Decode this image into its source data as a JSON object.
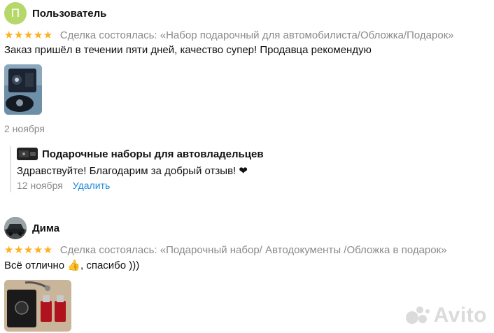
{
  "reviews": [
    {
      "avatar_letter": "П",
      "author": "Пользователь",
      "stars": "★★★★★",
      "rating": 5,
      "deal": "Сделка состоялась: «Набор подарочный для автомобилиста/Обложка/Подарок»",
      "text": "Заказ пришёл в течении пяти дней, качество супер! Продавца рекомендую",
      "date": "2 ноября",
      "reply": {
        "shop_name": "Подарочные наборы для автовладельцев",
        "text": "Здравствуйте! Благодарим за добрый отзыв! ❤",
        "date": "12 ноября",
        "delete_label": "Удалить"
      }
    },
    {
      "author": "Дима",
      "stars": "★★★★★",
      "rating": 5,
      "deal": "Сделка состоялась: «Подарочный набор/ Автодокументы /Обложка в подарок»",
      "text_before": "Всё отлично ",
      "thumb_emoji": "👍",
      "text_after": ", спасибо )))"
    }
  ],
  "watermark": "Avito",
  "colors": {
    "stars": "#ffb021",
    "link": "#1f8bd8",
    "muted": "#8a8a8a",
    "avatar_bg": "#b6d86a"
  }
}
